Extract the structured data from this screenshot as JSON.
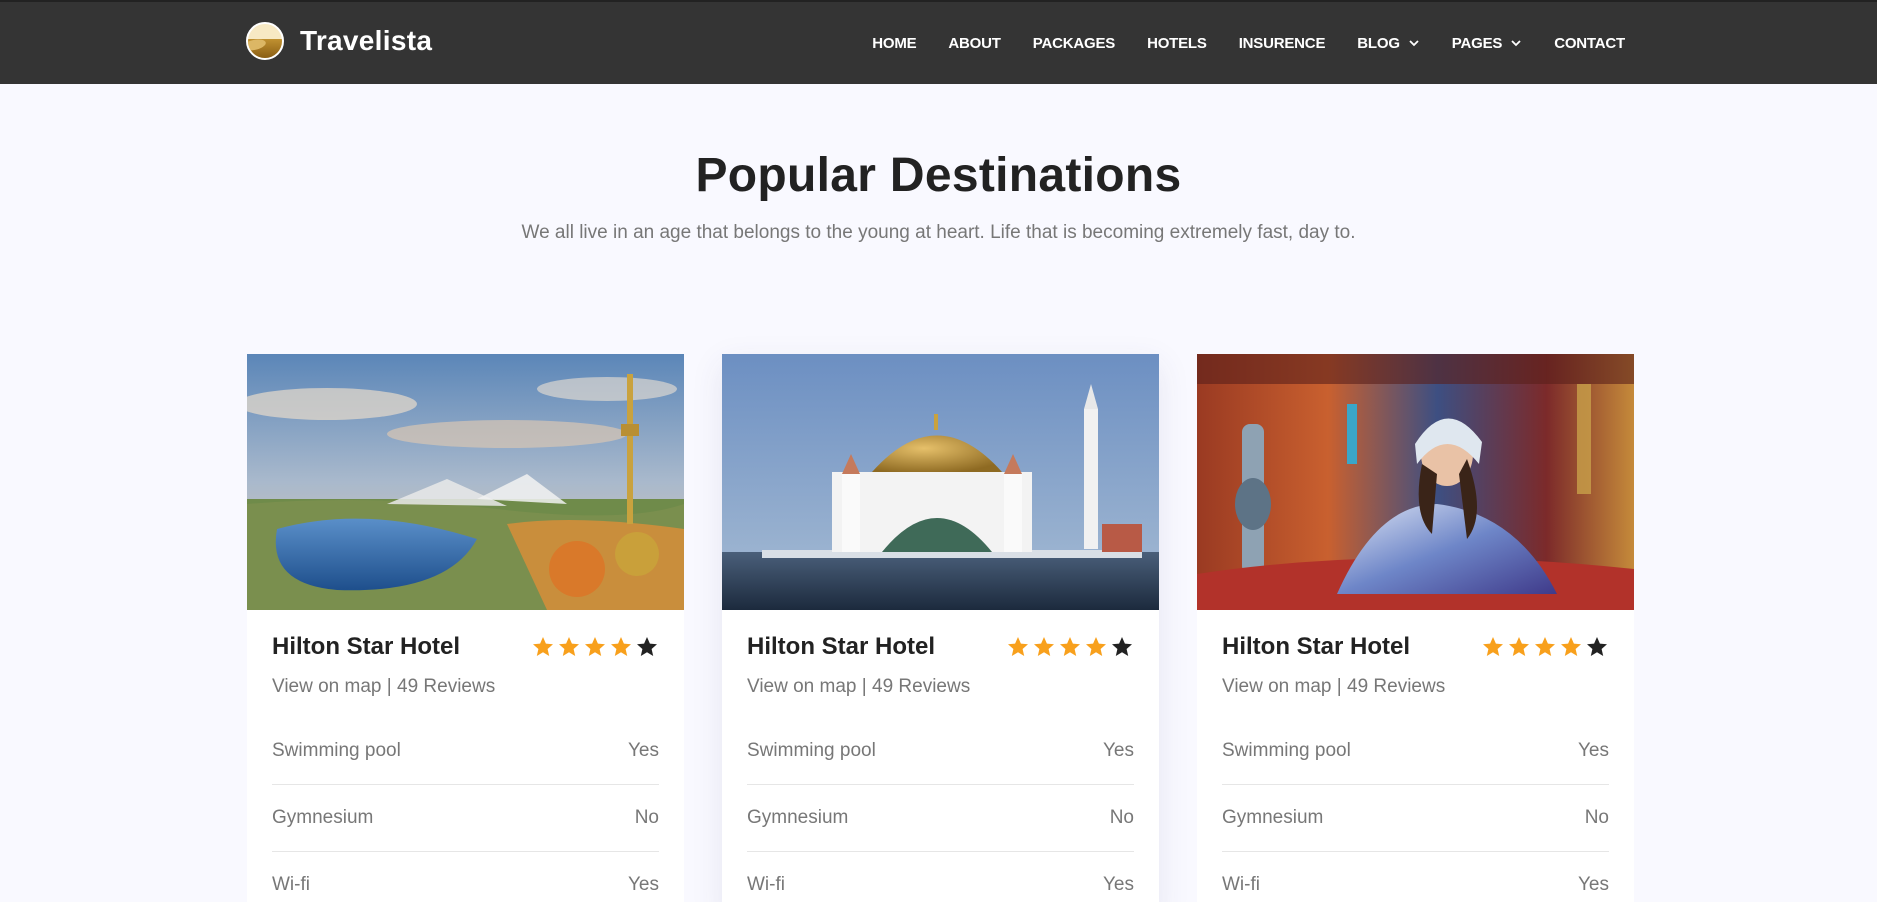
{
  "brand": {
    "name": "Travelista"
  },
  "nav": {
    "items": [
      {
        "label": "HOME"
      },
      {
        "label": "ABOUT"
      },
      {
        "label": "PACKAGES"
      },
      {
        "label": "HOTELS"
      },
      {
        "label": "INSURENCE"
      },
      {
        "label": "BLOG",
        "dropdown": true
      },
      {
        "label": "PAGES",
        "dropdown": true
      },
      {
        "label": "CONTACT"
      }
    ]
  },
  "section": {
    "title": "Popular Destinations",
    "subtitle": "We all live in an age that belongs to the young at heart. Life that is becoming extremely fast, day to."
  },
  "colors": {
    "navbar": "#343434",
    "star_filled": "#f8a01c",
    "star_empty": "#222222",
    "page_bg": "#f9f9ff"
  },
  "cards": [
    {
      "image": "munich-olympic-tower-lake",
      "name": "Hilton Star Hotel",
      "rating": 4,
      "rating_max": 5,
      "map_link": "View on map",
      "separator": " | ",
      "reviews": "49 Reviews",
      "amenities": [
        {
          "label": "Swimming pool",
          "value": "Yes"
        },
        {
          "label": "Gymnesium",
          "value": "No"
        },
        {
          "label": "Wi-fi",
          "value": "Yes"
        }
      ]
    },
    {
      "image": "floating-mosque",
      "name": "Hilton Star Hotel",
      "rating": 4,
      "rating_max": 5,
      "map_link": "View on map",
      "separator": " | ",
      "reviews": "49 Reviews",
      "amenities": [
        {
          "label": "Swimming pool",
          "value": "Yes"
        },
        {
          "label": "Gymnesium",
          "value": "No"
        },
        {
          "label": "Wi-fi",
          "value": "Yes"
        }
      ]
    },
    {
      "image": "woman-with-hookah",
      "name": "Hilton Star Hotel",
      "rating": 4,
      "rating_max": 5,
      "map_link": "View on map",
      "separator": " | ",
      "reviews": "49 Reviews",
      "amenities": [
        {
          "label": "Swimming pool",
          "value": "Yes"
        },
        {
          "label": "Gymnesium",
          "value": "No"
        },
        {
          "label": "Wi-fi",
          "value": "Yes"
        }
      ]
    }
  ]
}
